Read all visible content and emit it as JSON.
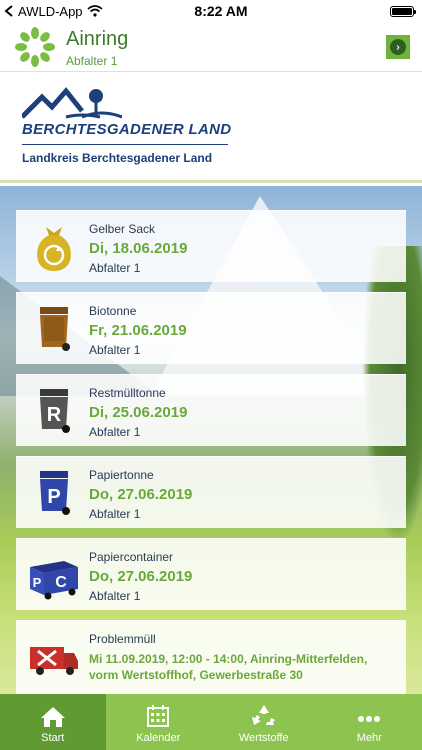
{
  "status_bar": {
    "carrier": "AWLD-App",
    "time": "8:22 AM"
  },
  "header": {
    "title": "Ainring",
    "subtitle": "Abfalter 1"
  },
  "logo": {
    "name": "BERCHTESGADENER LAND",
    "county": "Landkreis Berchtesgadener Land"
  },
  "entries": [
    {
      "type": "Gelber Sack",
      "date": "Di, 18.06.2019",
      "area": "Abfalter 1",
      "icon": "yellow-bag-icon"
    },
    {
      "type": "Biotonne",
      "date": "Fr, 21.06.2019",
      "area": "Abfalter 1",
      "icon": "brown-bin-icon"
    },
    {
      "type": "Restmülltonne",
      "date": "Di, 25.06.2019",
      "area": "Abfalter 1",
      "icon": "grey-bin-icon"
    },
    {
      "type": "Papiertonne",
      "date": "Do, 27.06.2019",
      "area": "Abfalter 1",
      "icon": "blue-bin-icon"
    },
    {
      "type": "Papiercontainer",
      "date": "Do, 27.06.2019",
      "area": "Abfalter 1",
      "icon": "paper-container-icon"
    },
    {
      "type": "Problemmüll",
      "detail": "Mi 11.09.2019, 12:00 - 14:00, Ainring-Mitterfelden, vorm Wertstoffhof, Gewerbestraße 30",
      "icon": "hazardous-truck-icon"
    }
  ],
  "tabs": [
    {
      "label": "Start",
      "icon": "home-icon",
      "active": true
    },
    {
      "label": "Kalender",
      "icon": "calendar-icon",
      "active": false
    },
    {
      "label": "Wertstoffe",
      "icon": "recycle-icon",
      "active": false
    },
    {
      "label": "Mehr",
      "icon": "more-icon",
      "active": false
    }
  ],
  "colors": {
    "brand_green": "#8cc44f",
    "active_tab": "#5f9b32",
    "date_green": "#6aa83a",
    "logo_blue": "#1d3f7a"
  }
}
